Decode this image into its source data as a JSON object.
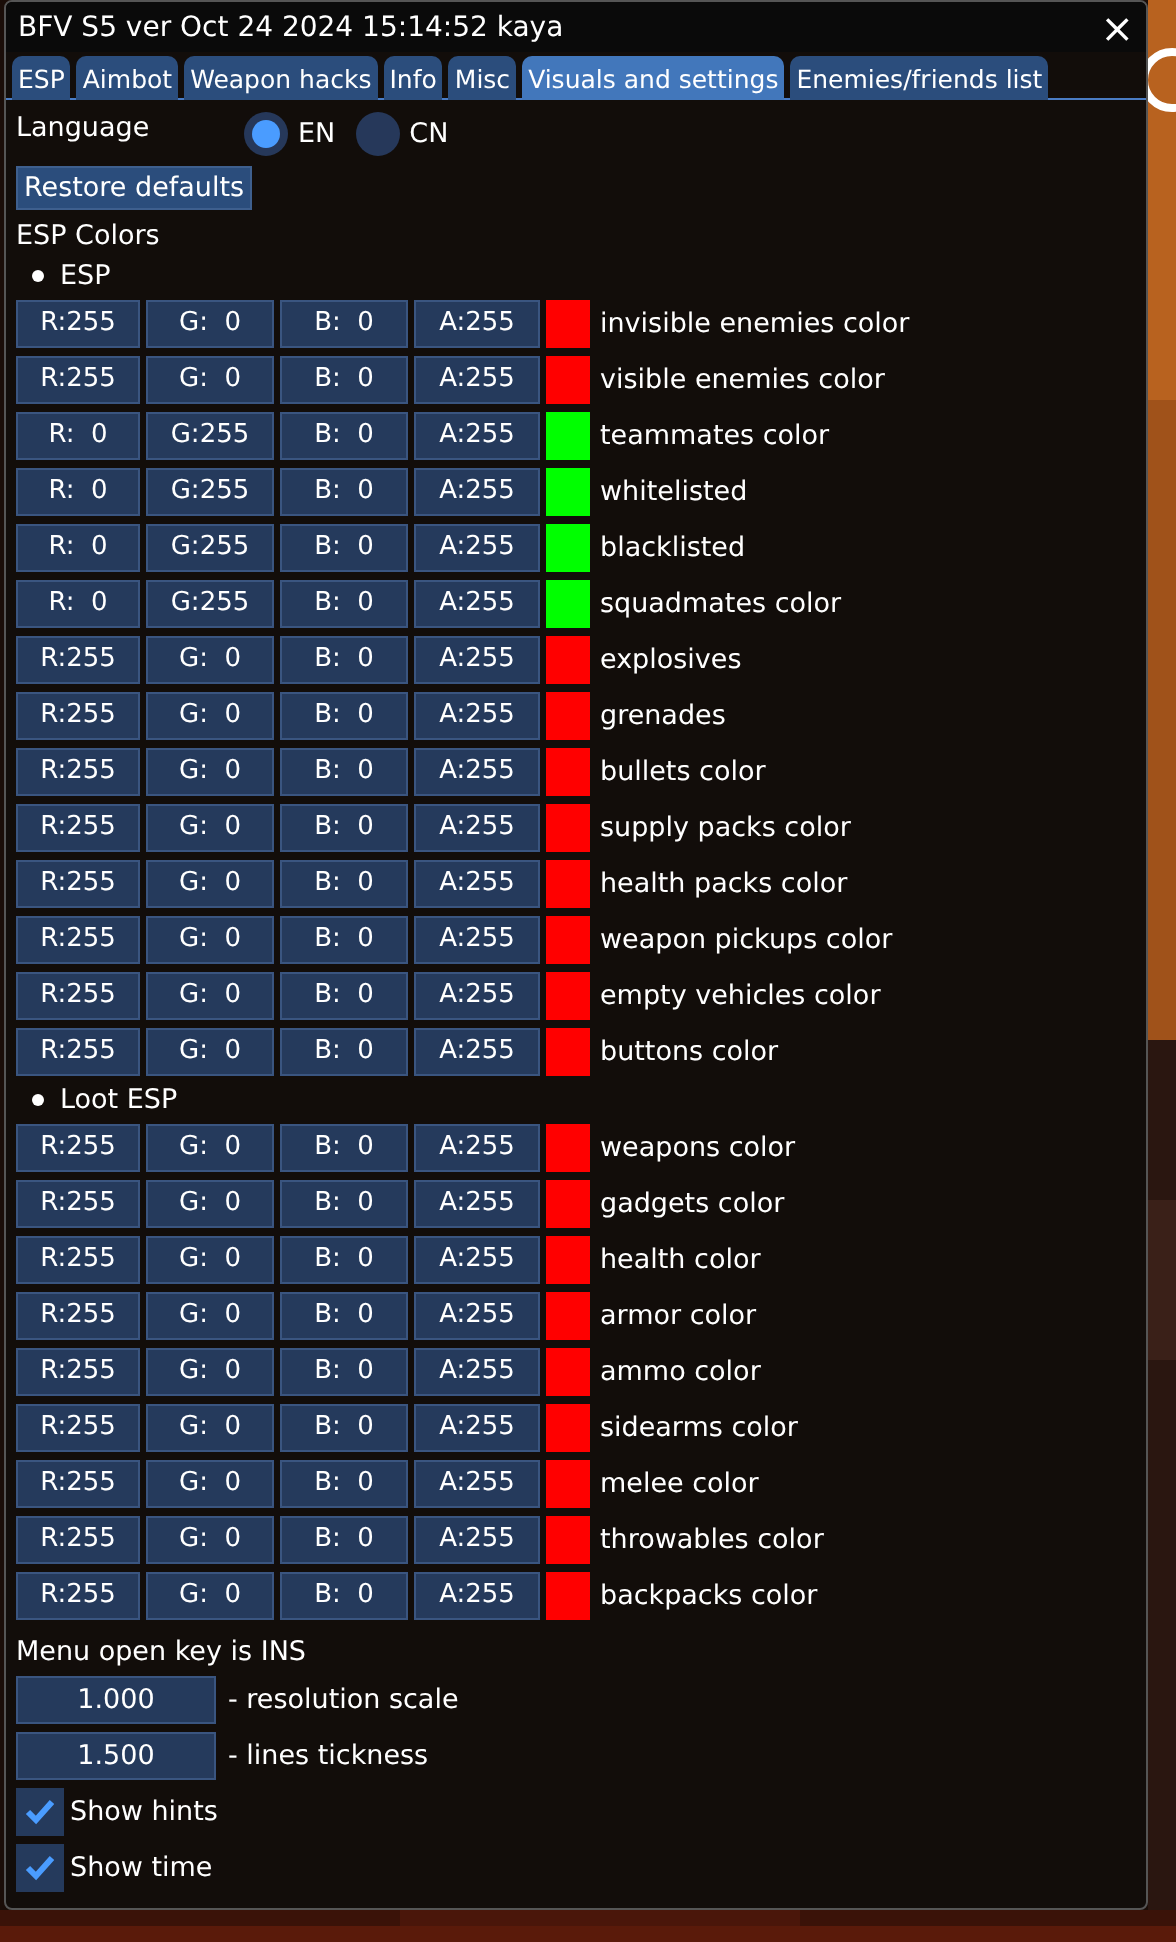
{
  "window": {
    "title": "BFV S5 ver Oct 24 2024 15:14:52 kaya",
    "close": "×"
  },
  "tabs": [
    {
      "label": "ESP",
      "selected": false
    },
    {
      "label": "Aimbot",
      "selected": false
    },
    {
      "label": "Weapon hacks",
      "selected": false
    },
    {
      "label": "Info",
      "selected": false
    },
    {
      "label": "Misc",
      "selected": false
    },
    {
      "label": "Visuals and settings",
      "selected": true
    },
    {
      "label": "Enemies/friends list",
      "selected": false
    }
  ],
  "language": {
    "label": "Language",
    "options": [
      {
        "label": "EN",
        "selected": true
      },
      {
        "label": "CN",
        "selected": false
      }
    ]
  },
  "restore_button": "Restore defaults",
  "esp_colors_heading": "ESP Colors",
  "sections": [
    {
      "title": "ESP",
      "rows": [
        {
          "r": "R:255",
          "g": "G:  0",
          "b": "B:  0",
          "a": "A:255",
          "color": "#ff0000",
          "label": "invisible enemies color"
        },
        {
          "r": "R:255",
          "g": "G:  0",
          "b": "B:  0",
          "a": "A:255",
          "color": "#ff0000",
          "label": "visible enemies color"
        },
        {
          "r": "R:  0",
          "g": "G:255",
          "b": "B:  0",
          "a": "A:255",
          "color": "#00ff00",
          "label": "teammates color"
        },
        {
          "r": "R:  0",
          "g": "G:255",
          "b": "B:  0",
          "a": "A:255",
          "color": "#00ff00",
          "label": "whitelisted"
        },
        {
          "r": "R:  0",
          "g": "G:255",
          "b": "B:  0",
          "a": "A:255",
          "color": "#00ff00",
          "label": "blacklisted"
        },
        {
          "r": "R:  0",
          "g": "G:255",
          "b": "B:  0",
          "a": "A:255",
          "color": "#00ff00",
          "label": "squadmates color"
        },
        {
          "r": "R:255",
          "g": "G:  0",
          "b": "B:  0",
          "a": "A:255",
          "color": "#ff0000",
          "label": "explosives"
        },
        {
          "r": "R:255",
          "g": "G:  0",
          "b": "B:  0",
          "a": "A:255",
          "color": "#ff0000",
          "label": "grenades"
        },
        {
          "r": "R:255",
          "g": "G:  0",
          "b": "B:  0",
          "a": "A:255",
          "color": "#ff0000",
          "label": "bullets color"
        },
        {
          "r": "R:255",
          "g": "G:  0",
          "b": "B:  0",
          "a": "A:255",
          "color": "#ff0000",
          "label": "supply packs color"
        },
        {
          "r": "R:255",
          "g": "G:  0",
          "b": "B:  0",
          "a": "A:255",
          "color": "#ff0000",
          "label": "health packs color"
        },
        {
          "r": "R:255",
          "g": "G:  0",
          "b": "B:  0",
          "a": "A:255",
          "color": "#ff0000",
          "label": "weapon pickups color"
        },
        {
          "r": "R:255",
          "g": "G:  0",
          "b": "B:  0",
          "a": "A:255",
          "color": "#ff0000",
          "label": "empty vehicles color"
        },
        {
          "r": "R:255",
          "g": "G:  0",
          "b": "B:  0",
          "a": "A:255",
          "color": "#ff0000",
          "label": "buttons color"
        }
      ]
    },
    {
      "title": "Loot ESP",
      "rows": [
        {
          "r": "R:255",
          "g": "G:  0",
          "b": "B:  0",
          "a": "A:255",
          "color": "#ff0000",
          "label": "weapons color"
        },
        {
          "r": "R:255",
          "g": "G:  0",
          "b": "B:  0",
          "a": "A:255",
          "color": "#ff0000",
          "label": "gadgets color"
        },
        {
          "r": "R:255",
          "g": "G:  0",
          "b": "B:  0",
          "a": "A:255",
          "color": "#ff0000",
          "label": "health color"
        },
        {
          "r": "R:255",
          "g": "G:  0",
          "b": "B:  0",
          "a": "A:255",
          "color": "#ff0000",
          "label": "armor color"
        },
        {
          "r": "R:255",
          "g": "G:  0",
          "b": "B:  0",
          "a": "A:255",
          "color": "#ff0000",
          "label": "ammo color"
        },
        {
          "r": "R:255",
          "g": "G:  0",
          "b": "B:  0",
          "a": "A:255",
          "color": "#ff0000",
          "label": "sidearms color"
        },
        {
          "r": "R:255",
          "g": "G:  0",
          "b": "B:  0",
          "a": "A:255",
          "color": "#ff0000",
          "label": "melee color"
        },
        {
          "r": "R:255",
          "g": "G:  0",
          "b": "B:  0",
          "a": "A:255",
          "color": "#ff0000",
          "label": "throwables color"
        },
        {
          "r": "R:255",
          "g": "G:  0",
          "b": "B:  0",
          "a": "A:255",
          "color": "#ff0000",
          "label": "backpacks color"
        }
      ]
    }
  ],
  "menu_key_text": "Menu open key is INS",
  "number_fields": [
    {
      "value": "1.000",
      "label": "- resolution scale"
    },
    {
      "value": "1.500",
      "label": "- lines tickness"
    }
  ],
  "checkboxes": [
    {
      "label": "Show hints",
      "checked": true
    },
    {
      "label": "Show time",
      "checked": true
    }
  ]
}
